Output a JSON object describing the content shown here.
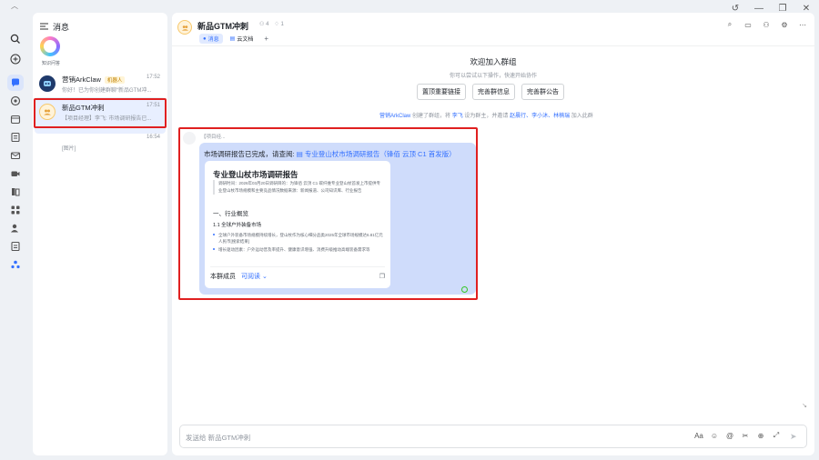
{
  "colors": {
    "accent": "#3370ff",
    "highlight_box": "#e02020",
    "bubble": "#cfdcfb",
    "selected_row": "#e8efff"
  },
  "sidebar": {
    "header_title": "消息",
    "knowledge_label": "知识问答",
    "conversations": [
      {
        "title": "营销ArkClaw",
        "tag": "机器人",
        "time": "17:52",
        "preview": "你好！已为你创建群聊“新品GTM冲..."
      },
      {
        "title": "新品GTM冲刺",
        "time": "17:51",
        "preview": "【项目经理】李飞: 市场调研报告已..."
      },
      {
        "title": "",
        "time": "16:54",
        "preview": "[图片]"
      }
    ]
  },
  "chat": {
    "title": "新品GTM冲刺",
    "member_count": "4",
    "meta_count": "1",
    "tabs": [
      "消息",
      "云文档"
    ],
    "add_tab": "+",
    "welcome_title": "欢迎加入群组",
    "welcome_sub": "你可以尝试以下操作，快速开始协作",
    "welcome_buttons": [
      "置顶重要链接",
      "完善群信息",
      "完善群公告"
    ],
    "system_line": {
      "actor": "营销ArkClaw",
      "text1": "创建了群组，将",
      "owner": "李飞",
      "text2": "设为群主，并邀请",
      "members": "赵晨行、李小沐、林楠瑞",
      "text3": "加入此群"
    },
    "message": {
      "sender": "【项目经...",
      "text_prefix": "市场调研报告已完成，请查阅:",
      "link_text": "专业登山杖市场调研报告（锋佰 云顶 C1 首发版）",
      "doc": {
        "title": "专业登山杖市场调研报告",
        "meta": "调研时间：2026年03月20日调研目的：为锋佰 云顶 C1 碳纤维专业登山杖首发上市提供专业登山杖市场规模和主要竞品情况数据来源：新闻报道、公司知识库、行业报告",
        "h1": "一、行业概览",
        "h2": "1.1 全球户外装备市场",
        "bullets": [
          "全球户外装备市场规模持续增长，登山杖作为核心细分品类2025年全球市场规模达6.81亿元人民币[搜索结果]",
          "增长驱动因素：户外运动普及率提升、健康意识增强、消费升级推动高端装备需求等"
        ],
        "footer_label": "本群成员",
        "footer_perm": "可阅读"
      }
    },
    "input_placeholder": "发送给 新品GTM冲刺"
  }
}
